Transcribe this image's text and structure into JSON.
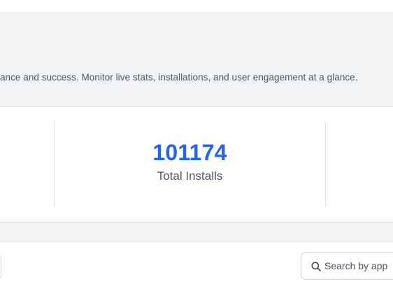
{
  "header": {
    "description": "ance and success. Monitor live stats, installations, and user engagement at a glance."
  },
  "stats": {
    "total_installs": {
      "value": "101174",
      "label": "Total Installs"
    }
  },
  "toolbar": {
    "search": {
      "placeholder": "Search by app",
      "value": ""
    }
  },
  "colors": {
    "accent": "#2563eb",
    "header_bg": "#f2f3f5",
    "text_muted": "#4b5563",
    "border": "#d1d5db"
  }
}
